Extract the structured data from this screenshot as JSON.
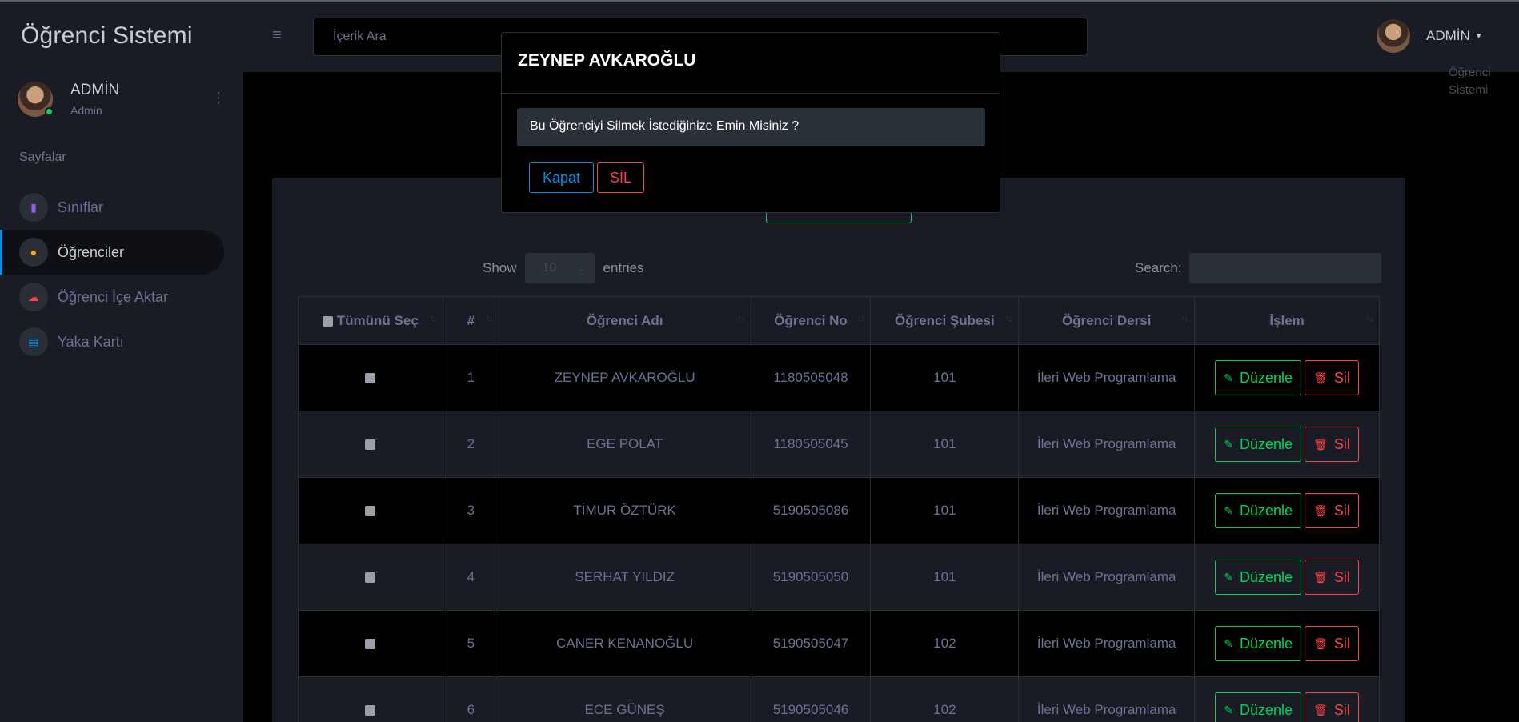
{
  "sidebar": {
    "brand": "Öğrenci Sistemi",
    "profile": {
      "name": "ADMİN",
      "role": "Admin"
    },
    "section_title": "Sayfalar",
    "items": [
      {
        "label": "Sınıflar",
        "icon": "book-icon",
        "color": "#8f5fe8"
      },
      {
        "label": "Öğrenciler",
        "icon": "user-icon",
        "color": "#ffab00"
      },
      {
        "label": "Öğrenci İçe Aktar",
        "icon": "cloud-upload-icon",
        "color": "#fc424a"
      },
      {
        "label": "Yaka Kartı",
        "icon": "id-card-icon",
        "color": "#0090e7"
      }
    ]
  },
  "topbar": {
    "search_placeholder": "İçerik Ara",
    "user_name": "ADMİN"
  },
  "breadcrumb": "Öğrenci Sistemi",
  "table_controls": {
    "show_label": "Show",
    "entries_value": "10",
    "entries_label": "entries",
    "search_label": "Search:"
  },
  "table": {
    "headers": [
      "Tümünü Seç",
      "#",
      "Öğrenci Adı",
      "Öğrenci No",
      "Öğrenci Şubesi",
      "Öğrenci Dersi",
      "İşlem"
    ],
    "rows": [
      {
        "no": "1",
        "name": "ZEYNEP AVKAROĞLU",
        "student_no": "1180505048",
        "branch": "101",
        "course": "İleri Web Programlama"
      },
      {
        "no": "2",
        "name": "EGE POLAT",
        "student_no": "1180505045",
        "branch": "101",
        "course": "İleri Web Programlama"
      },
      {
        "no": "3",
        "name": "TİMUR ÖZTÜRK",
        "student_no": "5190505086",
        "branch": "101",
        "course": "İleri Web Programlama"
      },
      {
        "no": "4",
        "name": "SERHAT YILDIZ",
        "student_no": "5190505050",
        "branch": "101",
        "course": "İleri Web Programlama"
      },
      {
        "no": "5",
        "name": "CANER KENANOĞLU",
        "student_no": "5190505047",
        "branch": "102",
        "course": "İleri Web Programlama"
      },
      {
        "no": "6",
        "name": "ECE GÜNEŞ",
        "student_no": "5190505046",
        "branch": "102",
        "course": "İleri Web Programlama"
      }
    ],
    "edit_label": "Düzenle",
    "delete_label": "Sil"
  },
  "modal": {
    "title": "ZEYNEP AVKAROĞLU",
    "message": "Bu Öğrenciyi Silmek İstediğinize Emin Misiniz ?",
    "close_label": "Kapat",
    "delete_label": "SİL"
  },
  "colors": {
    "success": "#00d25b",
    "danger": "#fc424a",
    "primary": "#0090e7"
  }
}
